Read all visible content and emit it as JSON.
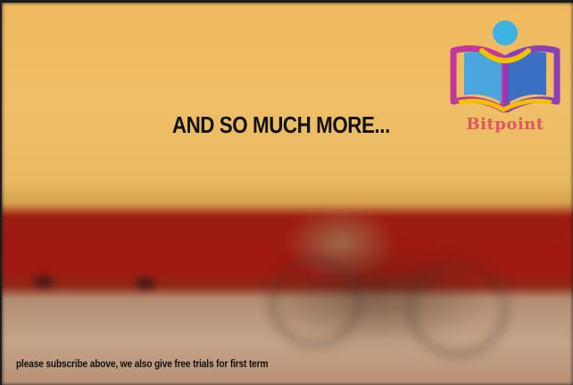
{
  "headline": "AND SO MUCH MORE...",
  "caption": "please subscribe above, we also give free trials for first term",
  "logo": {
    "name": "Bitpoint",
    "icon": "open-book-person-icon",
    "colors": {
      "book_left": "#4aa6dc",
      "book_right": "#3b6fc4",
      "head": "#3fb2e4",
      "outline_magenta": "#c0399a",
      "outline_purple": "#8a3fb6",
      "outline_yellow": "#f2c200",
      "name": "#e0565e"
    }
  },
  "colors": {
    "wall_yellow": "#efbf68",
    "stripe_red": "#a01a12",
    "floor_tan": "#c6a48a"
  }
}
